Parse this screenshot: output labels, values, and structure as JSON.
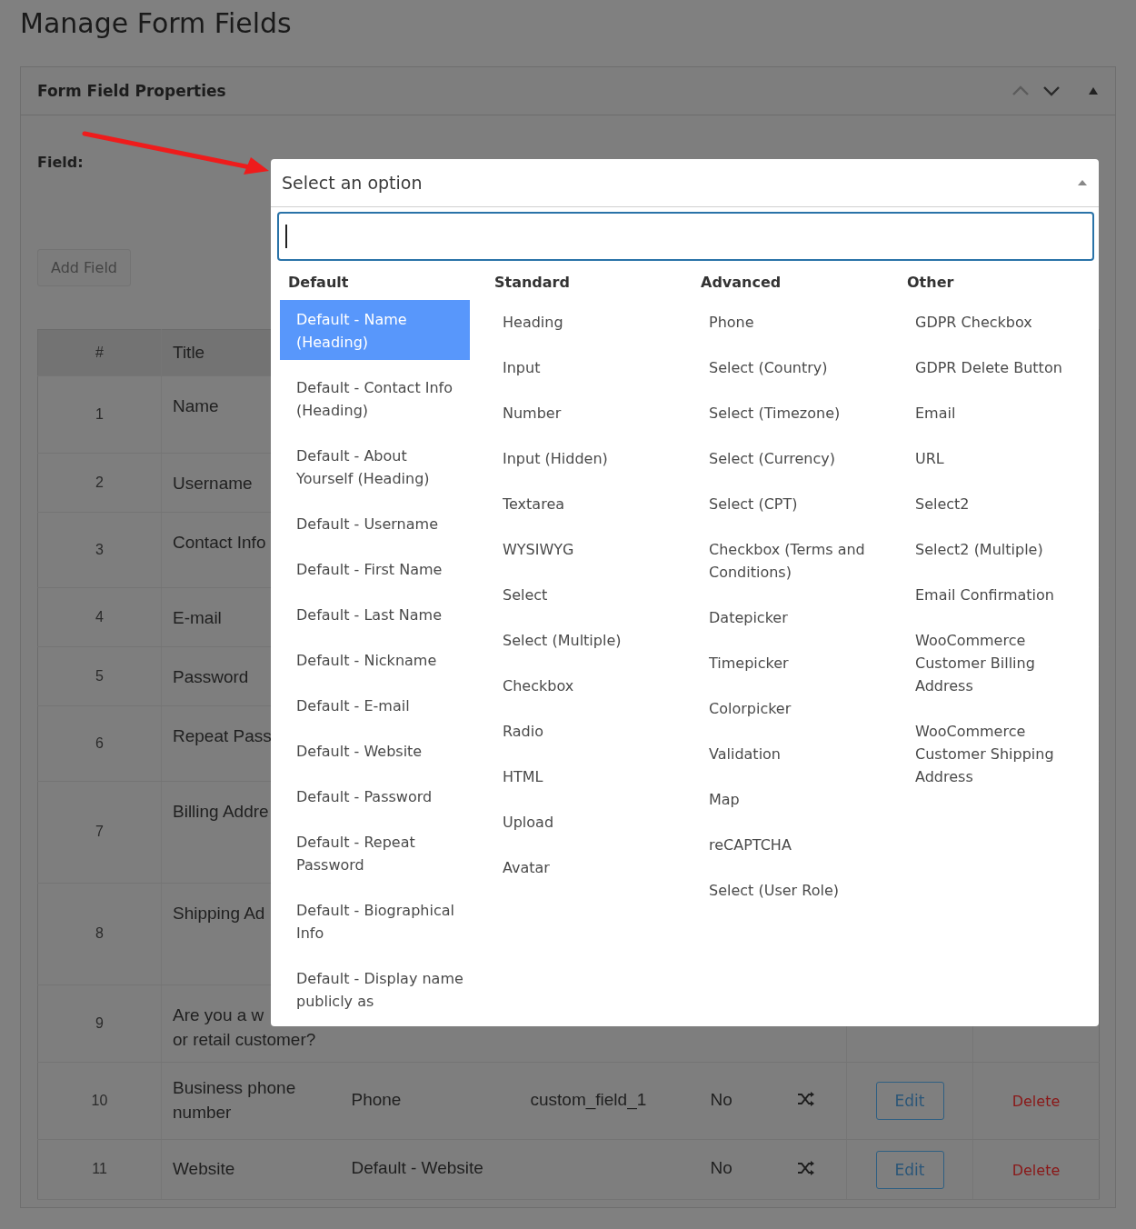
{
  "page": {
    "title": "Manage Form Fields"
  },
  "panel": {
    "title": "Form Field Properties",
    "field_label": "Field:",
    "add_button": {
      "label": "Add Field",
      "disabled": true
    }
  },
  "table": {
    "columns": [
      "#",
      "Title"
    ],
    "rows": [
      {
        "number": "1",
        "title": "Name"
      },
      {
        "number": "2",
        "title": "Username"
      },
      {
        "number": "3",
        "title": "Contact Info"
      },
      {
        "number": "4",
        "title": "E-mail"
      },
      {
        "number": "5",
        "title": "Password"
      },
      {
        "number": "6",
        "title": "Repeat Pass"
      },
      {
        "number": "7",
        "title": "Billing Addre"
      },
      {
        "number": "8",
        "title": "Shipping Ad"
      },
      {
        "number": "9",
        "title": "Are you a w\nor retail customer?"
      },
      {
        "number": "10",
        "title": "Business phone number",
        "type": "Phone",
        "meta_name": "custom_field_1",
        "required": "No",
        "edit": "Edit",
        "delete": "Delete"
      },
      {
        "number": "11",
        "title": "Website",
        "type": "Default - Website",
        "required": "No",
        "edit": "Edit",
        "delete": "Delete"
      }
    ]
  },
  "select": {
    "placeholder": "Select an option",
    "groups": [
      {
        "label": "Default",
        "options": [
          {
            "label": "Default - Name (Heading)",
            "selected": true
          },
          {
            "label": "Default - Contact Info (Heading)",
            "selected": false
          },
          {
            "label": "Default - About Yourself (Heading)",
            "selected": false
          },
          {
            "label": "Default - Username",
            "selected": false
          },
          {
            "label": "Default - First Name",
            "selected": false
          },
          {
            "label": "Default - Last Name",
            "selected": false
          },
          {
            "label": "Default - Nickname",
            "selected": false
          },
          {
            "label": "Default - E-mail",
            "selected": false
          },
          {
            "label": "Default - Website",
            "selected": false
          },
          {
            "label": "Default - Password",
            "selected": false
          },
          {
            "label": "Default - Repeat Password",
            "selected": false
          },
          {
            "label": "Default - Biographical Info",
            "selected": false
          },
          {
            "label": "Default - Display name publicly as",
            "selected": false
          }
        ]
      },
      {
        "label": "Standard",
        "options": [
          {
            "label": "Heading",
            "selected": false
          },
          {
            "label": "Input",
            "selected": false
          },
          {
            "label": "Number",
            "selected": false
          },
          {
            "label": "Input (Hidden)",
            "selected": false
          },
          {
            "label": "Textarea",
            "selected": false
          },
          {
            "label": "WYSIWYG",
            "selected": false
          },
          {
            "label": "Select",
            "selected": false
          },
          {
            "label": "Select (Multiple)",
            "selected": false
          },
          {
            "label": "Checkbox",
            "selected": false
          },
          {
            "label": "Radio",
            "selected": false
          },
          {
            "label": "HTML",
            "selected": false
          },
          {
            "label": "Upload",
            "selected": false
          },
          {
            "label": "Avatar",
            "selected": false
          }
        ]
      },
      {
        "label": "Advanced",
        "options": [
          {
            "label": "Phone",
            "selected": false
          },
          {
            "label": "Select (Country)",
            "selected": false
          },
          {
            "label": "Select (Timezone)",
            "selected": false
          },
          {
            "label": "Select (Currency)",
            "selected": false
          },
          {
            "label": "Select (CPT)",
            "selected": false
          },
          {
            "label": "Checkbox (Terms and Conditions)",
            "selected": false
          },
          {
            "label": "Datepicker",
            "selected": false
          },
          {
            "label": "Timepicker",
            "selected": false
          },
          {
            "label": "Colorpicker",
            "selected": false
          },
          {
            "label": "Validation",
            "selected": false
          },
          {
            "label": "Map",
            "selected": false
          },
          {
            "label": "reCAPTCHA",
            "selected": false
          },
          {
            "label": "Select (User Role)",
            "selected": false
          }
        ]
      },
      {
        "label": "Other",
        "options": [
          {
            "label": "GDPR Checkbox",
            "selected": false
          },
          {
            "label": "GDPR Delete Button",
            "selected": false
          },
          {
            "label": "Email",
            "selected": false
          },
          {
            "label": "URL",
            "selected": false
          },
          {
            "label": "Select2",
            "selected": false
          },
          {
            "label": "Select2 (Multiple)",
            "selected": false
          },
          {
            "label": "Email Confirmation",
            "selected": false
          },
          {
            "label": "WooCommerce Customer Billing Address",
            "selected": false
          },
          {
            "label": "WooCommerce Customer Shipping Address",
            "selected": false
          }
        ]
      }
    ]
  }
}
